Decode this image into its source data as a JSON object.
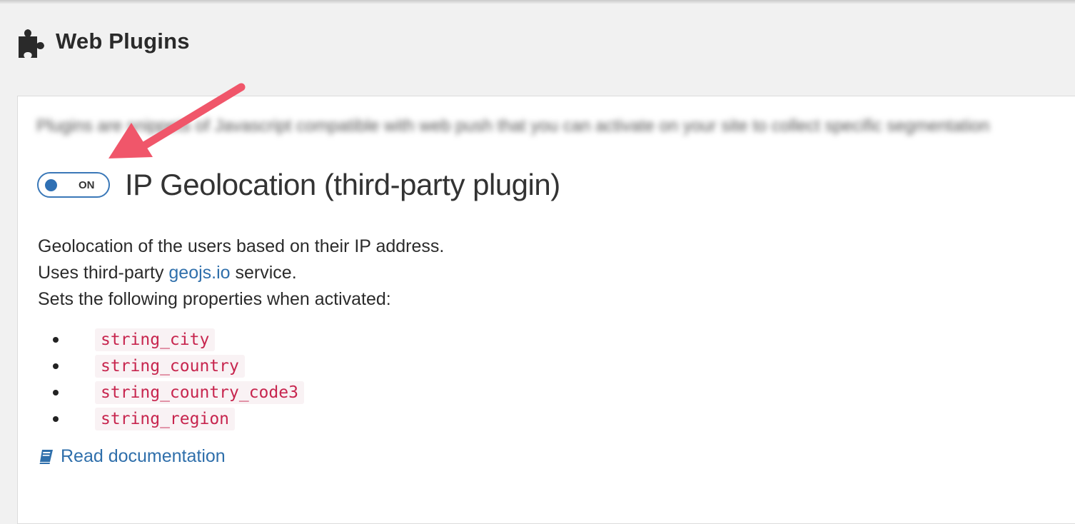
{
  "header": {
    "title": "Web Plugins",
    "icon": "puzzle-icon"
  },
  "panel": {
    "intro_text": "Plugins are snippets of Javascript compatible with web push that you can activate on your site to collect specific segmentation",
    "plugin": {
      "toggle_state": "ON",
      "name": "IP Geolocation (third-party plugin)",
      "description_line1": "Geolocation of the users based on their IP address.",
      "description_line2_prefix": "Uses third-party ",
      "description_line2_link": "geojs.io",
      "description_line2_suffix": " service.",
      "description_line3": "Sets the following properties when activated:",
      "properties": [
        "string_city",
        "string_country",
        "string_country_code3",
        "string_region"
      ],
      "doc_link": "Read documentation",
      "doc_icon": "book-icon"
    }
  },
  "annotation": {
    "arrow_color": "#f0566a"
  },
  "colors": {
    "link": "#2f6fab",
    "toggle_border": "#3a78b8",
    "code_text": "#c7254e",
    "code_bg": "#f9f2f4"
  }
}
